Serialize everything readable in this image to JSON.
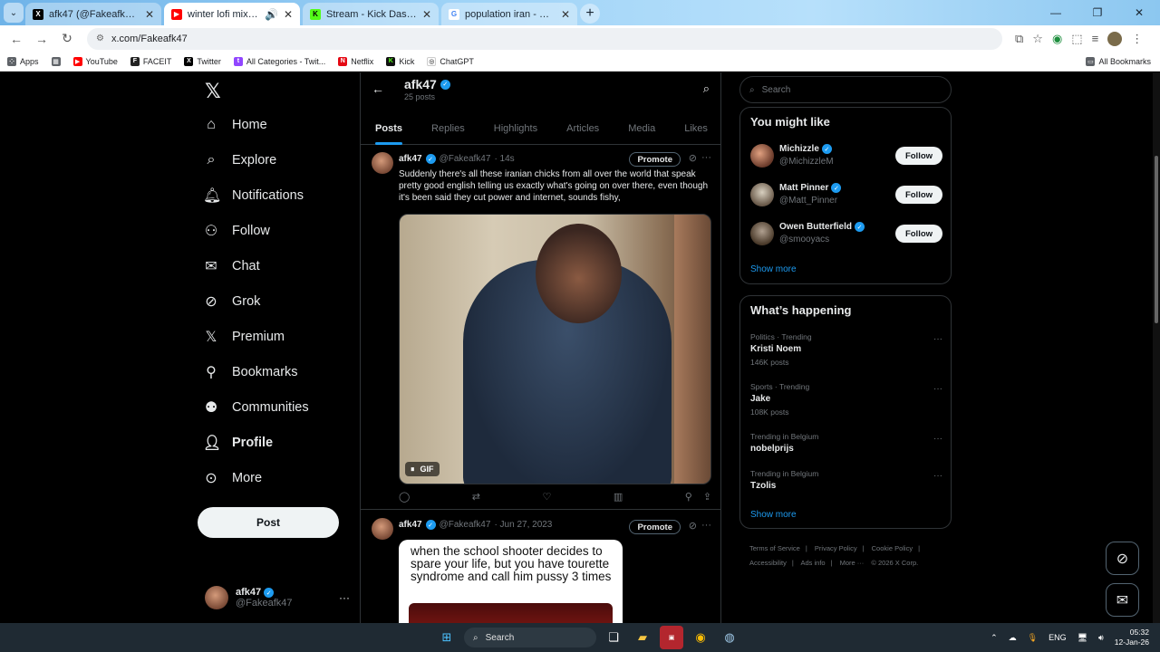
{
  "browser": {
    "tabs": [
      {
        "title": "afk47 (@Fakeafk47) / X",
        "favicon": "X",
        "fav_color": "#000000",
        "active": false
      },
      {
        "title": "winter lofi mix [3 hours]",
        "favicon": "▶",
        "fav_color": "#ff0000",
        "active": true
      },
      {
        "title": "Stream - Kick Dashboard",
        "favicon": "K",
        "fav_color": "#53fc18",
        "active": false
      },
      {
        "title": "population iran - Google Search",
        "favicon": "G",
        "fav_color": "#4285f4",
        "active": false
      }
    ],
    "url": "x.com/Fakeafk47",
    "bookmarks": [
      {
        "label": "Apps",
        "icon": "grid-icon"
      },
      {
        "label": "",
        "icon": "apps-grid-icon"
      },
      {
        "label": "YouTube",
        "icon": "youtube-icon",
        "color": "#ff0000"
      },
      {
        "label": "FACEIT",
        "icon": "faceit-icon",
        "color": "#ff5500"
      },
      {
        "label": "Twitter",
        "icon": "x-icon",
        "color": "#000000"
      },
      {
        "label": "All Categories - Twit...",
        "icon": "twitch-icon",
        "color": "#9146ff"
      },
      {
        "label": "Netflix",
        "icon": "netflix-icon",
        "color": "#e50914"
      },
      {
        "label": "Kick",
        "icon": "kick-icon",
        "color": "#53fc18"
      },
      {
        "label": "ChatGPT",
        "icon": "chatgpt-icon",
        "color": "#ffffff"
      }
    ],
    "all_bookmarks": "All Bookmarks"
  },
  "nav": {
    "items": [
      {
        "label": "Home",
        "icon": "home-icon"
      },
      {
        "label": "Explore",
        "icon": "search-icon"
      },
      {
        "label": "Notifications",
        "icon": "bell-icon"
      },
      {
        "label": "Follow",
        "icon": "follow-icon"
      },
      {
        "label": "Chat",
        "icon": "mail-icon"
      },
      {
        "label": "Grok",
        "icon": "grok-icon"
      },
      {
        "label": "Premium",
        "icon": "x-icon"
      },
      {
        "label": "Bookmarks",
        "icon": "bookmark-icon"
      },
      {
        "label": "Communities",
        "icon": "communities-icon"
      },
      {
        "label": "Profile",
        "icon": "profile-icon"
      },
      {
        "label": "More",
        "icon": "more-icon"
      }
    ],
    "post_label": "Post",
    "account": {
      "name": "afk47",
      "handle": "@Fakeafk47"
    }
  },
  "profile": {
    "name": "afk47",
    "post_count": "25 posts",
    "tabs": [
      "Posts",
      "Replies",
      "Highlights",
      "Articles",
      "Media",
      "Likes"
    ],
    "active_tab": "Posts"
  },
  "tweets": [
    {
      "name": "afk47",
      "handle": "@Fakeafk47",
      "time": "· 14s",
      "promote": "Promote",
      "text": "Suddenly there's all these iranian chicks from all over the world that speak pretty good english telling us exactly what's going on over there, even though it's been said they cut power and internet, sounds fishy,",
      "media_label": "GIF"
    },
    {
      "name": "afk47",
      "handle": "@Fakeafk47",
      "time": "· Jun 27, 2023",
      "promote": "Promote",
      "meme_text": "when the school shooter decides to spare your life, but you have tourette syndrome and call him pussy 3 times"
    }
  ],
  "right": {
    "search_placeholder": "Search",
    "you_might_like": "You might like",
    "suggestions": [
      {
        "name": "Michizzle",
        "handle": "@MichizzleM",
        "button": "Follow"
      },
      {
        "name": "Matt Pinner",
        "handle": "@Matt_Pinner",
        "button": "Follow"
      },
      {
        "name": "Owen Butterfield",
        "handle": "@smooyacs",
        "button": "Follow"
      }
    ],
    "show_more": "Show more",
    "whats_happening": "What’s happening",
    "trends": [
      {
        "context": "Politics · Trending",
        "topic": "Kristi Noem",
        "posts": "146K posts"
      },
      {
        "context": "Sports · Trending",
        "topic": "Jake",
        "posts": "108K posts"
      },
      {
        "context": "Trending in Belgium",
        "topic": "nobelprijs",
        "posts": ""
      },
      {
        "context": "Trending in Belgium",
        "topic": "Tzolis",
        "posts": ""
      }
    ],
    "footer": [
      "Terms of Service",
      "|",
      "Privacy Policy",
      "|",
      "Cookie Policy",
      "|",
      "Accessibility",
      "|",
      "Ads info",
      "|",
      "More ···",
      "© 2026 X Corp."
    ]
  },
  "taskbar": {
    "search": "Search",
    "lang": "ENG",
    "time": "05:32",
    "date": "12-Jan-26"
  }
}
